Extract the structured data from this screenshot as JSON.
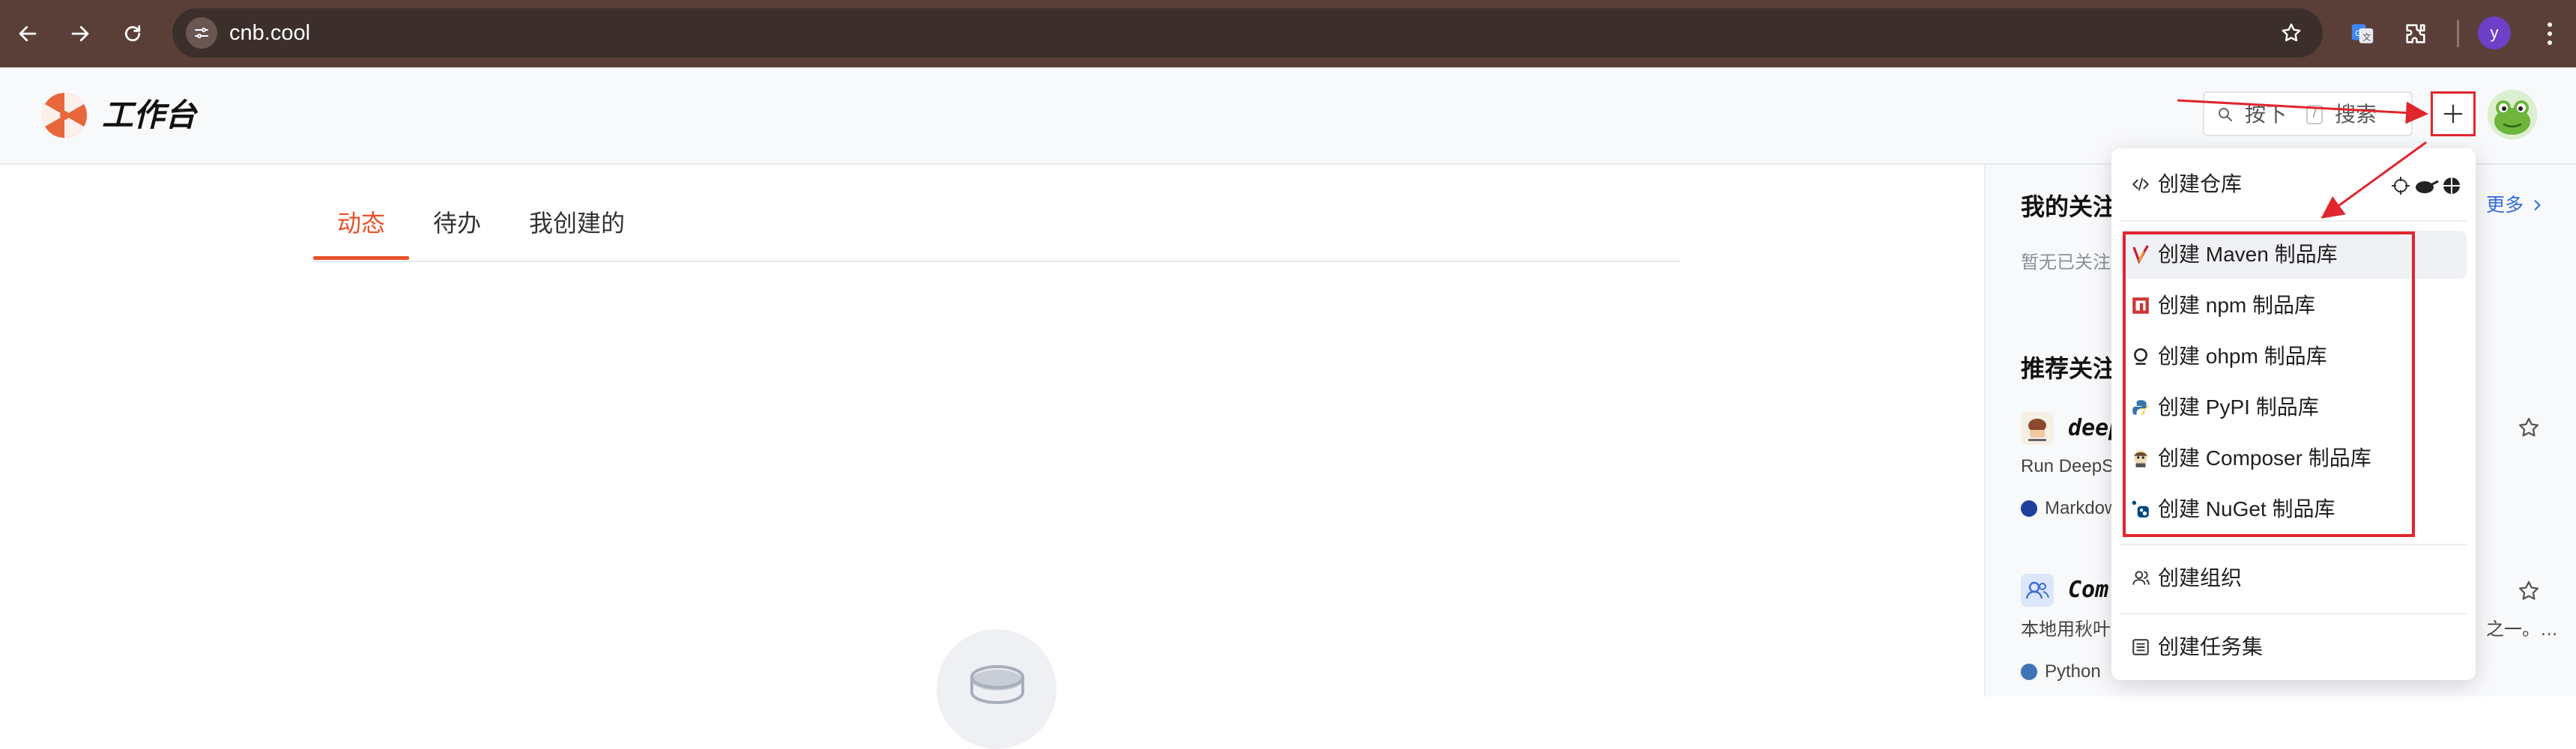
{
  "browser": {
    "url": "cnb.cool",
    "profile_initial": "y"
  },
  "header": {
    "app_title": "工作台",
    "search_prefix": "按下",
    "search_key": "/",
    "search_suffix": "搜索"
  },
  "tabs": [
    {
      "label": "动态",
      "active": true
    },
    {
      "label": "待办",
      "active": false
    },
    {
      "label": "我创建的",
      "active": false
    }
  ],
  "menu": {
    "items": [
      {
        "label": "创建仓库",
        "icon": "code-icon"
      },
      {
        "label": "创建 Maven 制品库",
        "icon": "maven-icon"
      },
      {
        "label": "创建 npm 制品库",
        "icon": "npm-icon"
      },
      {
        "label": "创建 ohpm 制品库",
        "icon": "ohpm-icon"
      },
      {
        "label": "创建 PyPI 制品库",
        "icon": "pypi-icon"
      },
      {
        "label": "创建 Composer 制品库",
        "icon": "composer-icon"
      },
      {
        "label": "创建 NuGet 制品库",
        "icon": "nuget-icon"
      },
      {
        "label": "创建组织",
        "icon": "organization-icon"
      },
      {
        "label": "创建任务集",
        "icon": "task-list-icon"
      }
    ]
  },
  "side": {
    "following_title": "我的关注",
    "following_empty": "暂无已关注",
    "more": "更多",
    "recommend_title": "推荐关注",
    "cards": [
      {
        "name": "deep",
        "desc": "Run DeepS",
        "lang": "Markdown",
        "lang_color": "#1f3fa0"
      },
      {
        "name": "Com",
        "desc": "本地用秋叶",
        "desc_tail": "之一。…",
        "lang": "Python",
        "lang_color": "#3f74b5"
      }
    ]
  },
  "colors": {
    "accent": "#e8522b",
    "annotation_red": "#e0262d",
    "link": "#2f6bd8"
  }
}
